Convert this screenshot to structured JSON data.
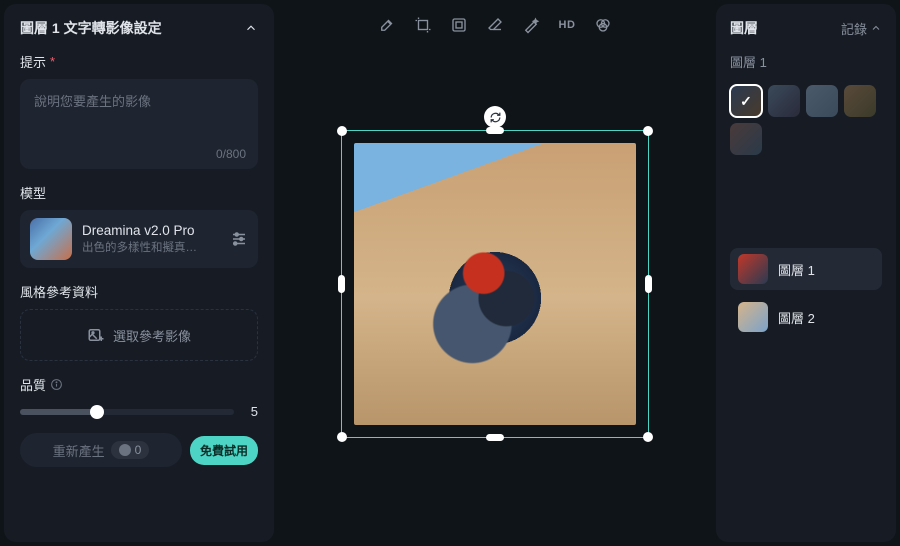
{
  "left": {
    "title": "圖層 1 文字轉影像設定",
    "prompt_label": "提示",
    "prompt_placeholder": "說明您要產生的影像",
    "prompt_counter": "0/800",
    "model_label": "模型",
    "model_name": "Dreamina v2.0 Pro",
    "model_desc": "出色的多樣性和擬真…",
    "style_ref_label": "風格參考資料",
    "style_ref_button": "選取參考影像",
    "quality_label": "品質",
    "quality_value": "5",
    "regenerate_label": "重新產生",
    "regenerate_cost": "0",
    "trial_label": "免費試用"
  },
  "toolbar": {
    "tools": [
      "brush",
      "crop",
      "frame",
      "eraser",
      "magic",
      "hd",
      "effects"
    ]
  },
  "right": {
    "title": "圖層",
    "history": "記錄",
    "current_layer": "圖層 1",
    "layers": [
      {
        "name": "圖層 1",
        "active": true
      },
      {
        "name": "圖層 2",
        "active": false
      }
    ]
  }
}
